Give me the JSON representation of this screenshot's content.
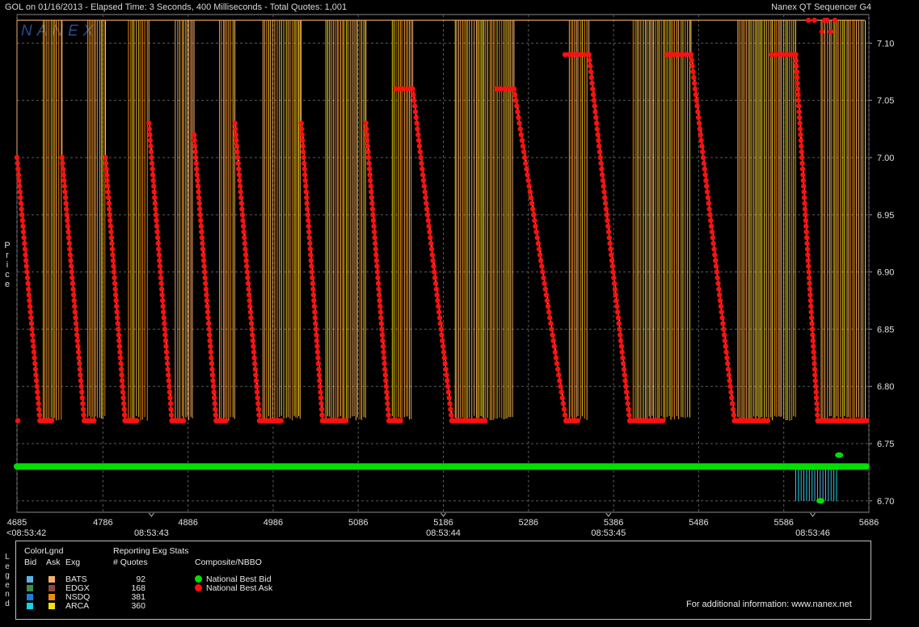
{
  "header": {
    "left_title": "GOL on 01/16/2013  -  Elapsed Time: 3 Seconds, 400 Milliseconds  -  Total Quotes: 1,001",
    "right_title": "Nanex QT Sequencer G4",
    "watermark": "NANEX"
  },
  "y_axis_label": "Price",
  "legend_side_label": "Legend",
  "chart_data": {
    "type": "line",
    "title": "GOL on 01/16/2013",
    "ylim": [
      6.69,
      7.125
    ],
    "xlim": [
      4685,
      5686
    ],
    "y_ticks": [
      "7.10",
      "7.05",
      "7.00",
      "6.95",
      "6.90",
      "6.85",
      "6.80",
      "6.75",
      "6.70"
    ],
    "x_ticks": [
      "4685",
      "4786",
      "4886",
      "4986",
      "5086",
      "5186",
      "5286",
      "5386",
      "5486",
      "5586",
      "5686"
    ],
    "time_labels": [
      "<08:53:42",
      "08:53:43",
      "08:53:44",
      "08:53:45",
      "08:53:46"
    ],
    "grid": true,
    "series": [
      {
        "name": "National Best Bid",
        "color": "#00e000",
        "value": 6.73
      },
      {
        "name": "National Best Ask",
        "color": "#ff1010",
        "sawtooth_cycles": [
          {
            "start": 4685,
            "end": 4712,
            "top": 7.0,
            "bottom": 6.77
          },
          {
            "start": 4738,
            "end": 4764,
            "top": 7.0,
            "bottom": 6.77
          },
          {
            "start": 4789,
            "end": 4812,
            "top": 7.0,
            "bottom": 6.77
          },
          {
            "start": 4840,
            "end": 4867,
            "top": 7.03,
            "bottom": 6.77
          },
          {
            "start": 4893,
            "end": 4919,
            "top": 7.02,
            "bottom": 6.77
          },
          {
            "start": 4941,
            "end": 4970,
            "top": 7.03,
            "bottom": 6.77
          },
          {
            "start": 5019,
            "end": 5044,
            "top": 7.03,
            "bottom": 6.77
          },
          {
            "start": 5095,
            "end": 5122,
            "top": 7.03,
            "bottom": 6.77
          },
          {
            "start": 5150,
            "end": 5196,
            "top": 7.06,
            "bottom": 6.77
          },
          {
            "start": 5269,
            "end": 5330,
            "top": 7.06,
            "bottom": 6.77
          },
          {
            "start": 5357,
            "end": 5405,
            "top": 7.09,
            "bottom": 6.77
          },
          {
            "start": 5477,
            "end": 5528,
            "top": 7.09,
            "bottom": 6.77
          },
          {
            "start": 5600,
            "end": 5626,
            "top": 7.09,
            "bottom": 6.77
          }
        ]
      }
    ]
  },
  "legend": {
    "colorlgnd_title": "ColorLgnd",
    "bid_header": "Bid",
    "ask_header": "Ask",
    "exg_header": "Exg",
    "reporting_title": "Reporting Exg Stats",
    "quotes_header": "# Quotes",
    "composite_title": "Composite/NBBO",
    "exchanges": [
      {
        "name": "BATS",
        "quotes": "92",
        "bid_color": "#5ab4e6",
        "ask_color": "#f5b066"
      },
      {
        "name": "EDGX",
        "quotes": "168",
        "bid_color": "#3f8f4a",
        "ask_color": "#8c4a3c"
      },
      {
        "name": "NSDQ",
        "quotes": "381",
        "bid_color": "#1a7fd6",
        "ask_color": "#f08a10"
      },
      {
        "name": "ARCA",
        "quotes": "360",
        "bid_color": "#10d6e6",
        "ask_color": "#f5e010"
      }
    ],
    "nbbo": [
      {
        "label": "National Best Bid",
        "color": "#00e000"
      },
      {
        "label": "National Best Ask",
        "color": "#ff1010"
      }
    ],
    "footer": "For additional information: www.nanex.net"
  }
}
